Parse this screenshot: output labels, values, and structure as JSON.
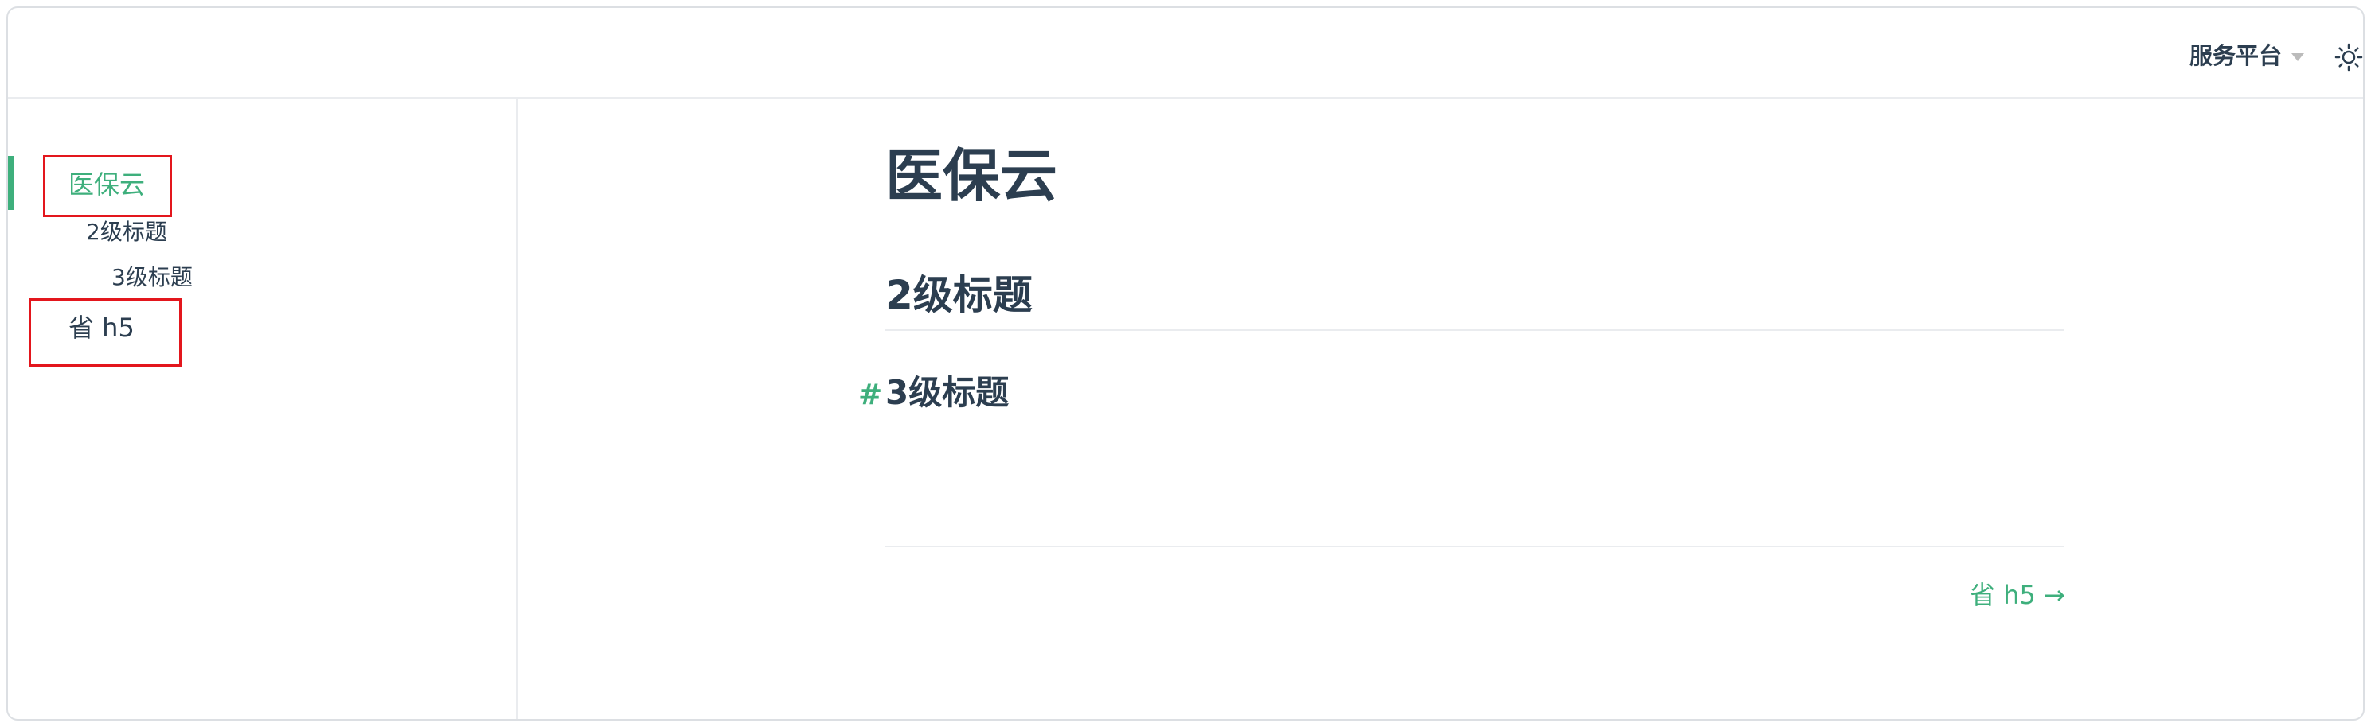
{
  "navbar": {
    "dropdown_label": "服务平台",
    "dropdown_icon": "chevron-down-icon",
    "theme_icon": "sun-icon"
  },
  "sidebar": {
    "items": [
      {
        "label": "医保云",
        "level": 1,
        "active": true
      },
      {
        "label": "2级标题",
        "level": 2,
        "active": false
      },
      {
        "label": "3级标题",
        "level": 3,
        "active": false
      },
      {
        "label": "省 h5",
        "level": 1,
        "active": false
      }
    ]
  },
  "content": {
    "title": "医保云",
    "h2": "2级标题",
    "h3_anchor": "#",
    "h3": "3级标题",
    "next_link": {
      "label": "省 h5",
      "arrow": "→"
    }
  },
  "colors": {
    "accent": "#3eaf7c",
    "text": "#2c3e50",
    "border": "#eaecef",
    "annotation": "#e3161d"
  }
}
